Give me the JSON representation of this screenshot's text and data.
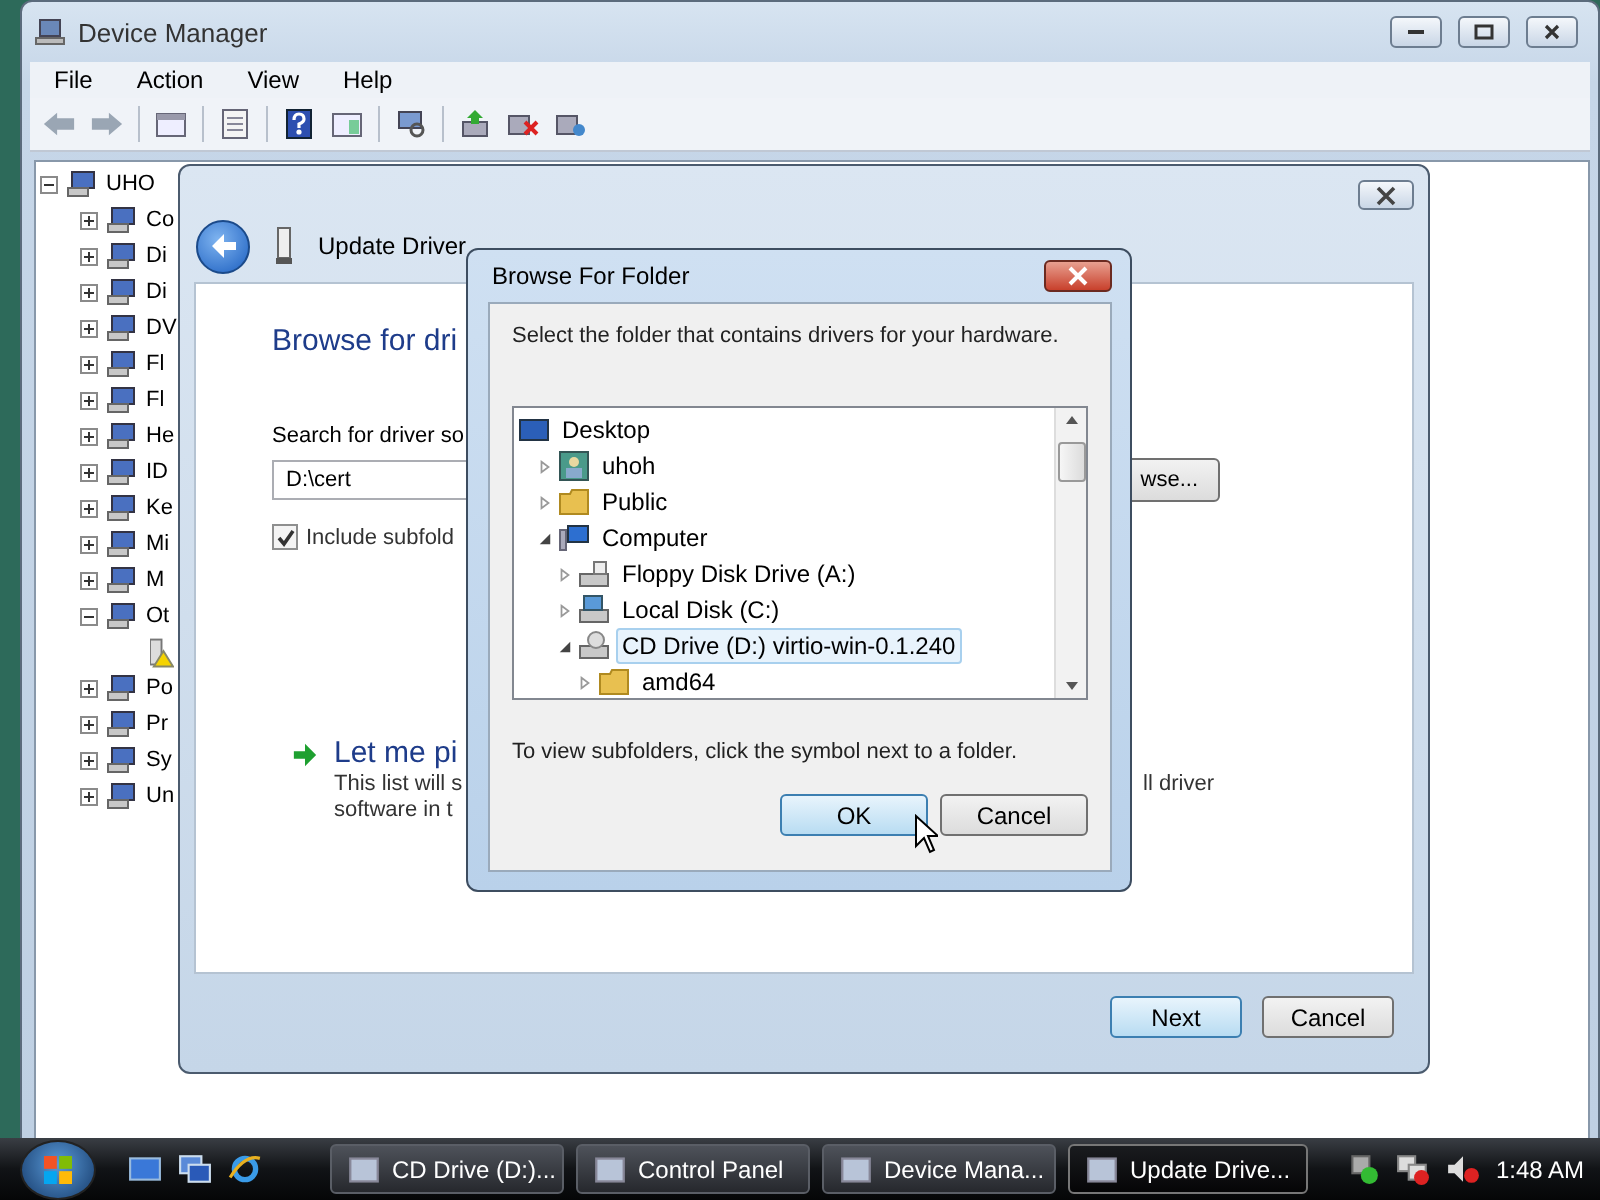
{
  "device_manager": {
    "title": "Device Manager",
    "menu": [
      "File",
      "Action",
      "View",
      "Help"
    ],
    "tree": {
      "label": "UHO",
      "expanded": true,
      "children": [
        {
          "label": "Co",
          "expanded": false
        },
        {
          "label": "Di",
          "expanded": false
        },
        {
          "label": "Di",
          "expanded": false
        },
        {
          "label": "DV",
          "expanded": false
        },
        {
          "label": "Fl",
          "expanded": false
        },
        {
          "label": "Fl",
          "expanded": false
        },
        {
          "label": "He",
          "expanded": false
        },
        {
          "label": "ID",
          "expanded": false
        },
        {
          "label": "Ke",
          "expanded": false
        },
        {
          "label": "Mi",
          "expanded": false
        },
        {
          "label": "M",
          "expanded": false
        },
        {
          "label": "Ot",
          "expanded": true,
          "children": [
            {
              "warning": true
            }
          ]
        },
        {
          "label": "Po",
          "expanded": false
        },
        {
          "label": "Pr",
          "expanded": false
        },
        {
          "label": "Sy",
          "expanded": false
        },
        {
          "label": "Un",
          "expanded": false
        }
      ]
    }
  },
  "update_dialog": {
    "title": "Update Driver",
    "heading": "Browse for dri",
    "search_label": "Search for driver so",
    "path": "D:\\cert",
    "browse_button": "wse...",
    "include_subfolders": {
      "label": "Include subfold",
      "checked": true
    },
    "pick_option": {
      "title": "Let me pi",
      "description_start": "This list will s",
      "description_end": "ll driver",
      "description_line_2": "software in t"
    },
    "buttons": [
      {
        "label": "Next",
        "default": true
      },
      {
        "label": "Cancel",
        "default": false
      }
    ]
  },
  "browse_dialog": {
    "title": "Browse For Folder",
    "instruction": "Select the folder that contains drivers for your hardware.",
    "tree": [
      {
        "label": "Desktop",
        "kind": "desktop",
        "selected": false,
        "children": [
          {
            "label": "uhoh",
            "kind": "user",
            "expanded": false,
            "selected": false
          },
          {
            "label": "Public",
            "kind": "folder",
            "expanded": false,
            "selected": false
          },
          {
            "label": "Computer",
            "kind": "computer",
            "expanded": true,
            "selected": false,
            "children": [
              {
                "label": "Floppy Disk Drive (A:)",
                "kind": "floppy",
                "expanded": false,
                "selected": false
              },
              {
                "label": "Local Disk (C:)",
                "kind": "drive",
                "expanded": false,
                "selected": false
              },
              {
                "label": "CD Drive (D:) virtio-win-0.1.240",
                "kind": "cd",
                "expanded": true,
                "selected": true,
                "children": [
                  {
                    "label": "amd64",
                    "kind": "folder",
                    "expanded": false,
                    "selected": false
                  }
                ]
              }
            ]
          }
        ]
      }
    ],
    "hint": "To view subfolders, click the symbol next to a folder.",
    "buttons": [
      {
        "label": "OK",
        "default": true
      },
      {
        "label": "Cancel",
        "default": false
      }
    ]
  },
  "taskbar": {
    "tasks": [
      {
        "label": "CD Drive (D:)...",
        "selected": false
      },
      {
        "label": "Control Panel",
        "selected": false
      },
      {
        "label": "Device Mana...",
        "selected": false
      },
      {
        "label": "Update Drive...",
        "selected": true
      }
    ],
    "clock": "1:48 AM"
  }
}
